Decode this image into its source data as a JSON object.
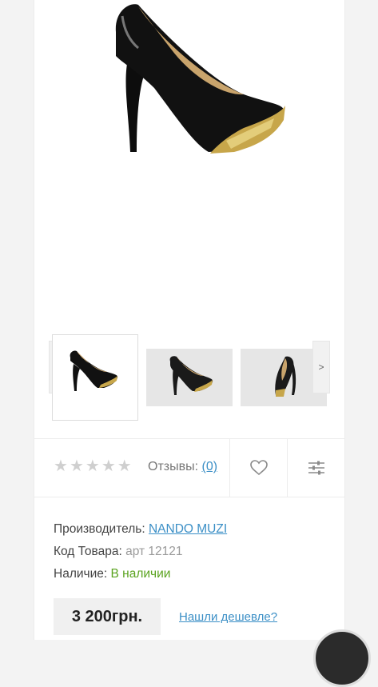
{
  "gallery": {
    "prev_label": "<",
    "next_label": ">",
    "thumbnails": [
      "black-patent-pump-gold-heel",
      "black-pump-side-view",
      "black-pump-front-view"
    ]
  },
  "rating": {
    "stars": [
      "★",
      "★",
      "★",
      "★",
      "★"
    ],
    "reviews_label": "Отзывы:",
    "reviews_count": "(0)"
  },
  "product": {
    "manufacturer_label": "Производитель:",
    "manufacturer_value": "NANDO MUZI",
    "code_label": "Код Товара:",
    "code_value": "арт 12121",
    "availability_label": "Наличие:",
    "availability_value": "В наличии"
  },
  "purchase": {
    "price": "3 200грн.",
    "cheaper_link": "Нашли дешевле?"
  },
  "colors": {
    "accent_link": "#3b8fc6",
    "in_stock": "#5aa31f"
  }
}
